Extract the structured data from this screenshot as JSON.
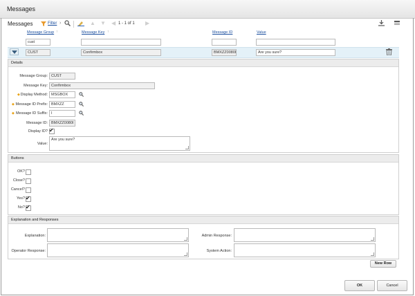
{
  "dialog": {
    "title": "Messages"
  },
  "toolbar": {
    "title": "Messages",
    "filter_label": "Filter",
    "pagination": "1 - 1 of 1"
  },
  "table": {
    "columns": [
      "Message Group",
      "Message Key",
      "Message ID",
      "Value"
    ],
    "filter_values": {
      "message_group": "cust",
      "message_key": "",
      "message_id": "",
      "value": ""
    },
    "rows": [
      {
        "message_group": "CUST",
        "message_key": "Confirmbox",
        "message_id": "BMXZZ0080I",
        "value": "Are you sure?"
      }
    ]
  },
  "details": {
    "header": "Details",
    "message_group_label": "Message Group:",
    "message_group_value": "CUST",
    "message_key_label": "Message Key:",
    "message_key_value": "Confirmbox",
    "display_method_label": "Display Method:",
    "display_method_value": "MSGBOX",
    "prefix_label": "Message ID Prefix:",
    "prefix_value": "BMXZZ",
    "suffix_label": "Message ID Suffix:",
    "suffix_value": "I",
    "message_id_label": "Message ID:",
    "message_id_value": "BMXZZ0080I",
    "display_id_label": "Display ID?",
    "display_id_checked": true,
    "value_label": "Value:",
    "value_value": "Are you sure?"
  },
  "buttons_section": {
    "header": "Buttons",
    "ok_label": "OK?",
    "close_label": "Close?",
    "cancel_label": "Cancel?",
    "yes_label": "Yes?",
    "no_label": "No?"
  },
  "explanation_section": {
    "header": "Explanation and Responses",
    "explanation_label": "Explanation:",
    "operator_response_label": "Operator Response:",
    "admin_response_label": "Admin Response:",
    "system_action_label": "System Action:"
  },
  "actions": {
    "new_row_label": "New Row",
    "ok_label": "OK",
    "cancel_label": "Cancel"
  },
  "icons": {
    "required": "diamond",
    "lookup": "magnifier-icon",
    "delete": "trash-icon",
    "check_glyph": "✔"
  }
}
